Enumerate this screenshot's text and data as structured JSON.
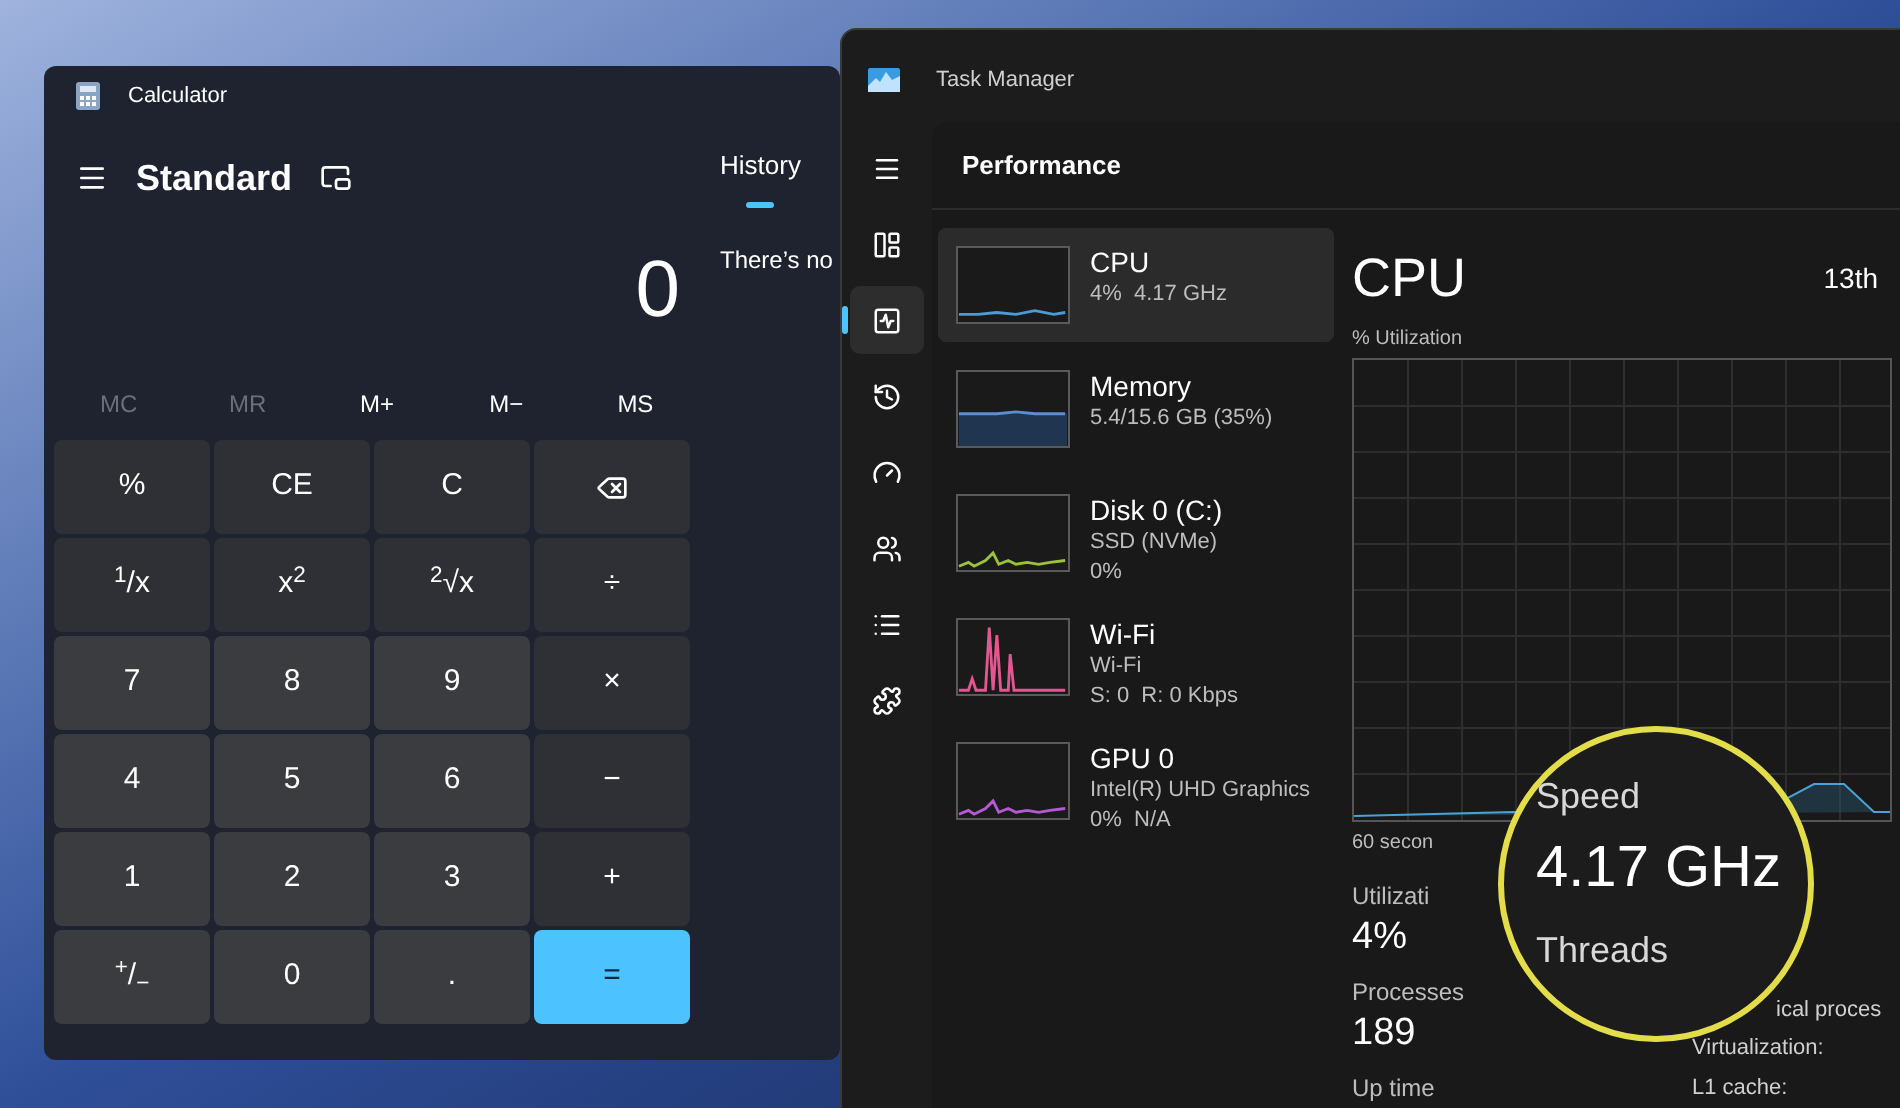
{
  "calculator": {
    "title": "Calculator",
    "mode": "Standard",
    "display": "0",
    "history_tab": {
      "label": "History",
      "selected": true
    },
    "history_message": "There’s no",
    "memory": [
      {
        "label": "MC",
        "disabled": true
      },
      {
        "label": "MR",
        "disabled": true
      },
      {
        "label": "M+",
        "disabled": false
      },
      {
        "label": "M−",
        "disabled": false
      },
      {
        "label": "MS",
        "disabled": false
      }
    ],
    "keys": [
      {
        "label": "%",
        "kind": "function"
      },
      {
        "label": "CE",
        "kind": "function"
      },
      {
        "label": "C",
        "kind": "function"
      },
      {
        "kind": "backspace"
      },
      {
        "label": "$^{1}$/x",
        "kind": "function"
      },
      {
        "label": "x$^{2}$",
        "kind": "function"
      },
      {
        "label": "$^{2}$√x",
        "kind": "function"
      },
      {
        "label": "÷",
        "kind": "function"
      },
      {
        "label": "7",
        "kind": "digit"
      },
      {
        "label": "8",
        "kind": "digit"
      },
      {
        "label": "9",
        "kind": "digit"
      },
      {
        "label": "×",
        "kind": "function"
      },
      {
        "label": "4",
        "kind": "digit"
      },
      {
        "label": "5",
        "kind": "digit"
      },
      {
        "label": "6",
        "kind": "digit"
      },
      {
        "label": "−",
        "kind": "function"
      },
      {
        "label": "1",
        "kind": "digit"
      },
      {
        "label": "2",
        "kind": "digit"
      },
      {
        "label": "3",
        "kind": "digit"
      },
      {
        "label": "+",
        "kind": "function"
      },
      {
        "label": "$^{+}$/$_{−}$",
        "kind": "digit"
      },
      {
        "label": "0",
        "kind": "digit"
      },
      {
        "label": ".",
        "kind": "digit"
      },
      {
        "label": "=",
        "kind": "equals"
      }
    ]
  },
  "task_manager": {
    "title": "Task Manager",
    "header": "Performance",
    "nav": [
      {
        "kind": "menu",
        "selected": false
      },
      {
        "kind": "processes",
        "selected": false
      },
      {
        "kind": "performance",
        "selected": true
      },
      {
        "kind": "history",
        "selected": false
      },
      {
        "kind": "startup",
        "selected": false
      },
      {
        "kind": "users",
        "selected": false
      },
      {
        "kind": "details",
        "selected": false
      },
      {
        "kind": "services",
        "selected": false
      }
    ],
    "devices": [
      {
        "name": "CPU",
        "lines": [
          "4%  4.17 GHz"
        ],
        "selected": true,
        "color": "#4a9bd6",
        "kind": "line"
      },
      {
        "name": "Memory",
        "lines": [
          "5.4/15.6 GB (35%)"
        ],
        "selected": false,
        "color": "#5b8fd0",
        "kind": "area"
      },
      {
        "name": "Disk 0 (C:)",
        "lines": [
          "SSD (NVMe)",
          "0%"
        ],
        "selected": false,
        "color": "#9bc23c",
        "kind": "spikes"
      },
      {
        "name": "Wi-Fi",
        "lines": [
          "Wi-Fi",
          "S: 0  R: 0 Kbps"
        ],
        "selected": false,
        "color": "#e0588f",
        "kind": "tall"
      },
      {
        "name": "GPU 0",
        "lines": [
          "Intel(R) UHD Graphics",
          "0%  N/A"
        ],
        "selected": false,
        "color": "#b55ad6",
        "kind": "spikes"
      }
    ],
    "detail": {
      "title": "CPU",
      "processor": "13th",
      "graph_label": "% Utilization",
      "time_label": "60 secon",
      "stats": [
        {
          "label": "Utilizati",
          "value": "4%"
        },
        {
          "label": "Processes",
          "value": "189"
        }
      ],
      "uptime_label": "Up time",
      "magnified": {
        "label": "Speed",
        "value": "4.17 GHz",
        "next_label": "Threads"
      },
      "right_labels": [
        "ical proces",
        "Virtualization:",
        "L1 cache:"
      ]
    }
  }
}
